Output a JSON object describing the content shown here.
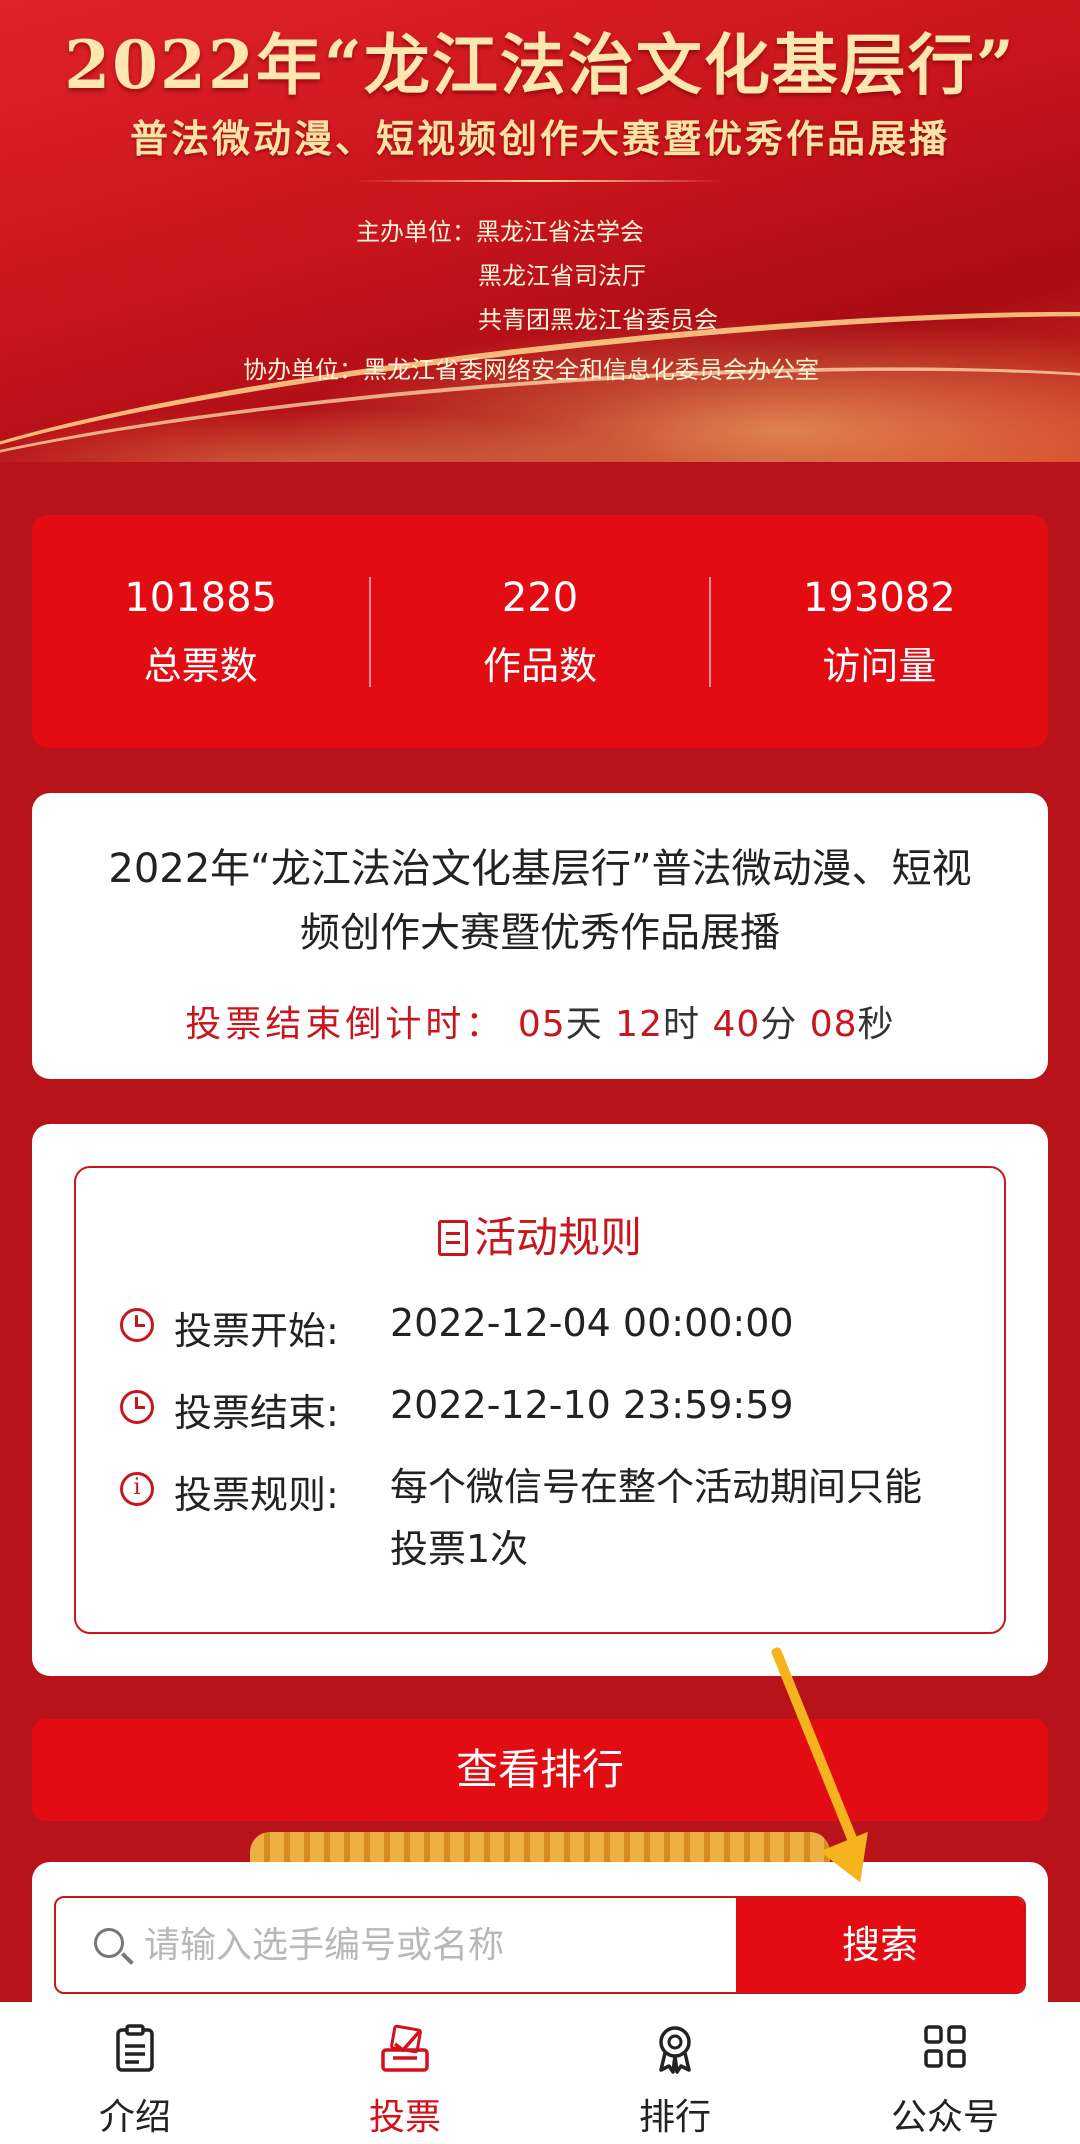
{
  "banner": {
    "title": "2022年“龙江法治文化基层行”",
    "subtitle": "普法微动漫、短视频创作大赛暨优秀作品展播",
    "organizer_label": "主办单位：",
    "organizers": [
      "黑龙江省法学会",
      "黑龙江省司法厅",
      "共青团黑龙江省委员会"
    ],
    "co_organizer_label": "协办单位：",
    "co_organizer": "黑龙江省委网络安全和信息化委员会办公室"
  },
  "stats": [
    {
      "value": "101885",
      "label": "总票数"
    },
    {
      "value": "220",
      "label": "作品数"
    },
    {
      "value": "193082",
      "label": "访问量"
    }
  ],
  "event": {
    "title": "2022年“龙江法治文化基层行”普法微动漫、短视频创作大赛暨优秀作品展播",
    "countdown_label": "投票结束倒计时：",
    "days": "05",
    "days_unit": "天",
    "hours": "12",
    "hours_unit": "时",
    "minutes": "40",
    "minutes_unit": "分",
    "seconds": "08",
    "seconds_unit": "秒"
  },
  "rules": {
    "heading": "活动规则",
    "items": [
      {
        "key": "投票开始:",
        "value": "2022-12-04 00:00:00",
        "icon": "clock-icon"
      },
      {
        "key": "投票结束:",
        "value": "2022-12-10 23:59:59",
        "icon": "clock-icon"
      },
      {
        "key": "投票规则:",
        "value": "每个微信号在整个活动期间只能投票1次",
        "icon": "info-icon"
      }
    ]
  },
  "ranking_button": "查看排行",
  "search": {
    "placeholder": "请输入选手编号或名称",
    "button": "搜索"
  },
  "nav": [
    {
      "label": "介绍",
      "icon": "clipboard-icon",
      "active": false
    },
    {
      "label": "投票",
      "icon": "ballot-icon",
      "active": true
    },
    {
      "label": "排行",
      "icon": "award-icon",
      "active": false
    },
    {
      "label": "公众号",
      "icon": "grid-icon",
      "active": false
    }
  ],
  "colors": {
    "primary_red": "#e30c13",
    "background_red": "#b8121a",
    "accent_gold": "#f5b41e"
  }
}
